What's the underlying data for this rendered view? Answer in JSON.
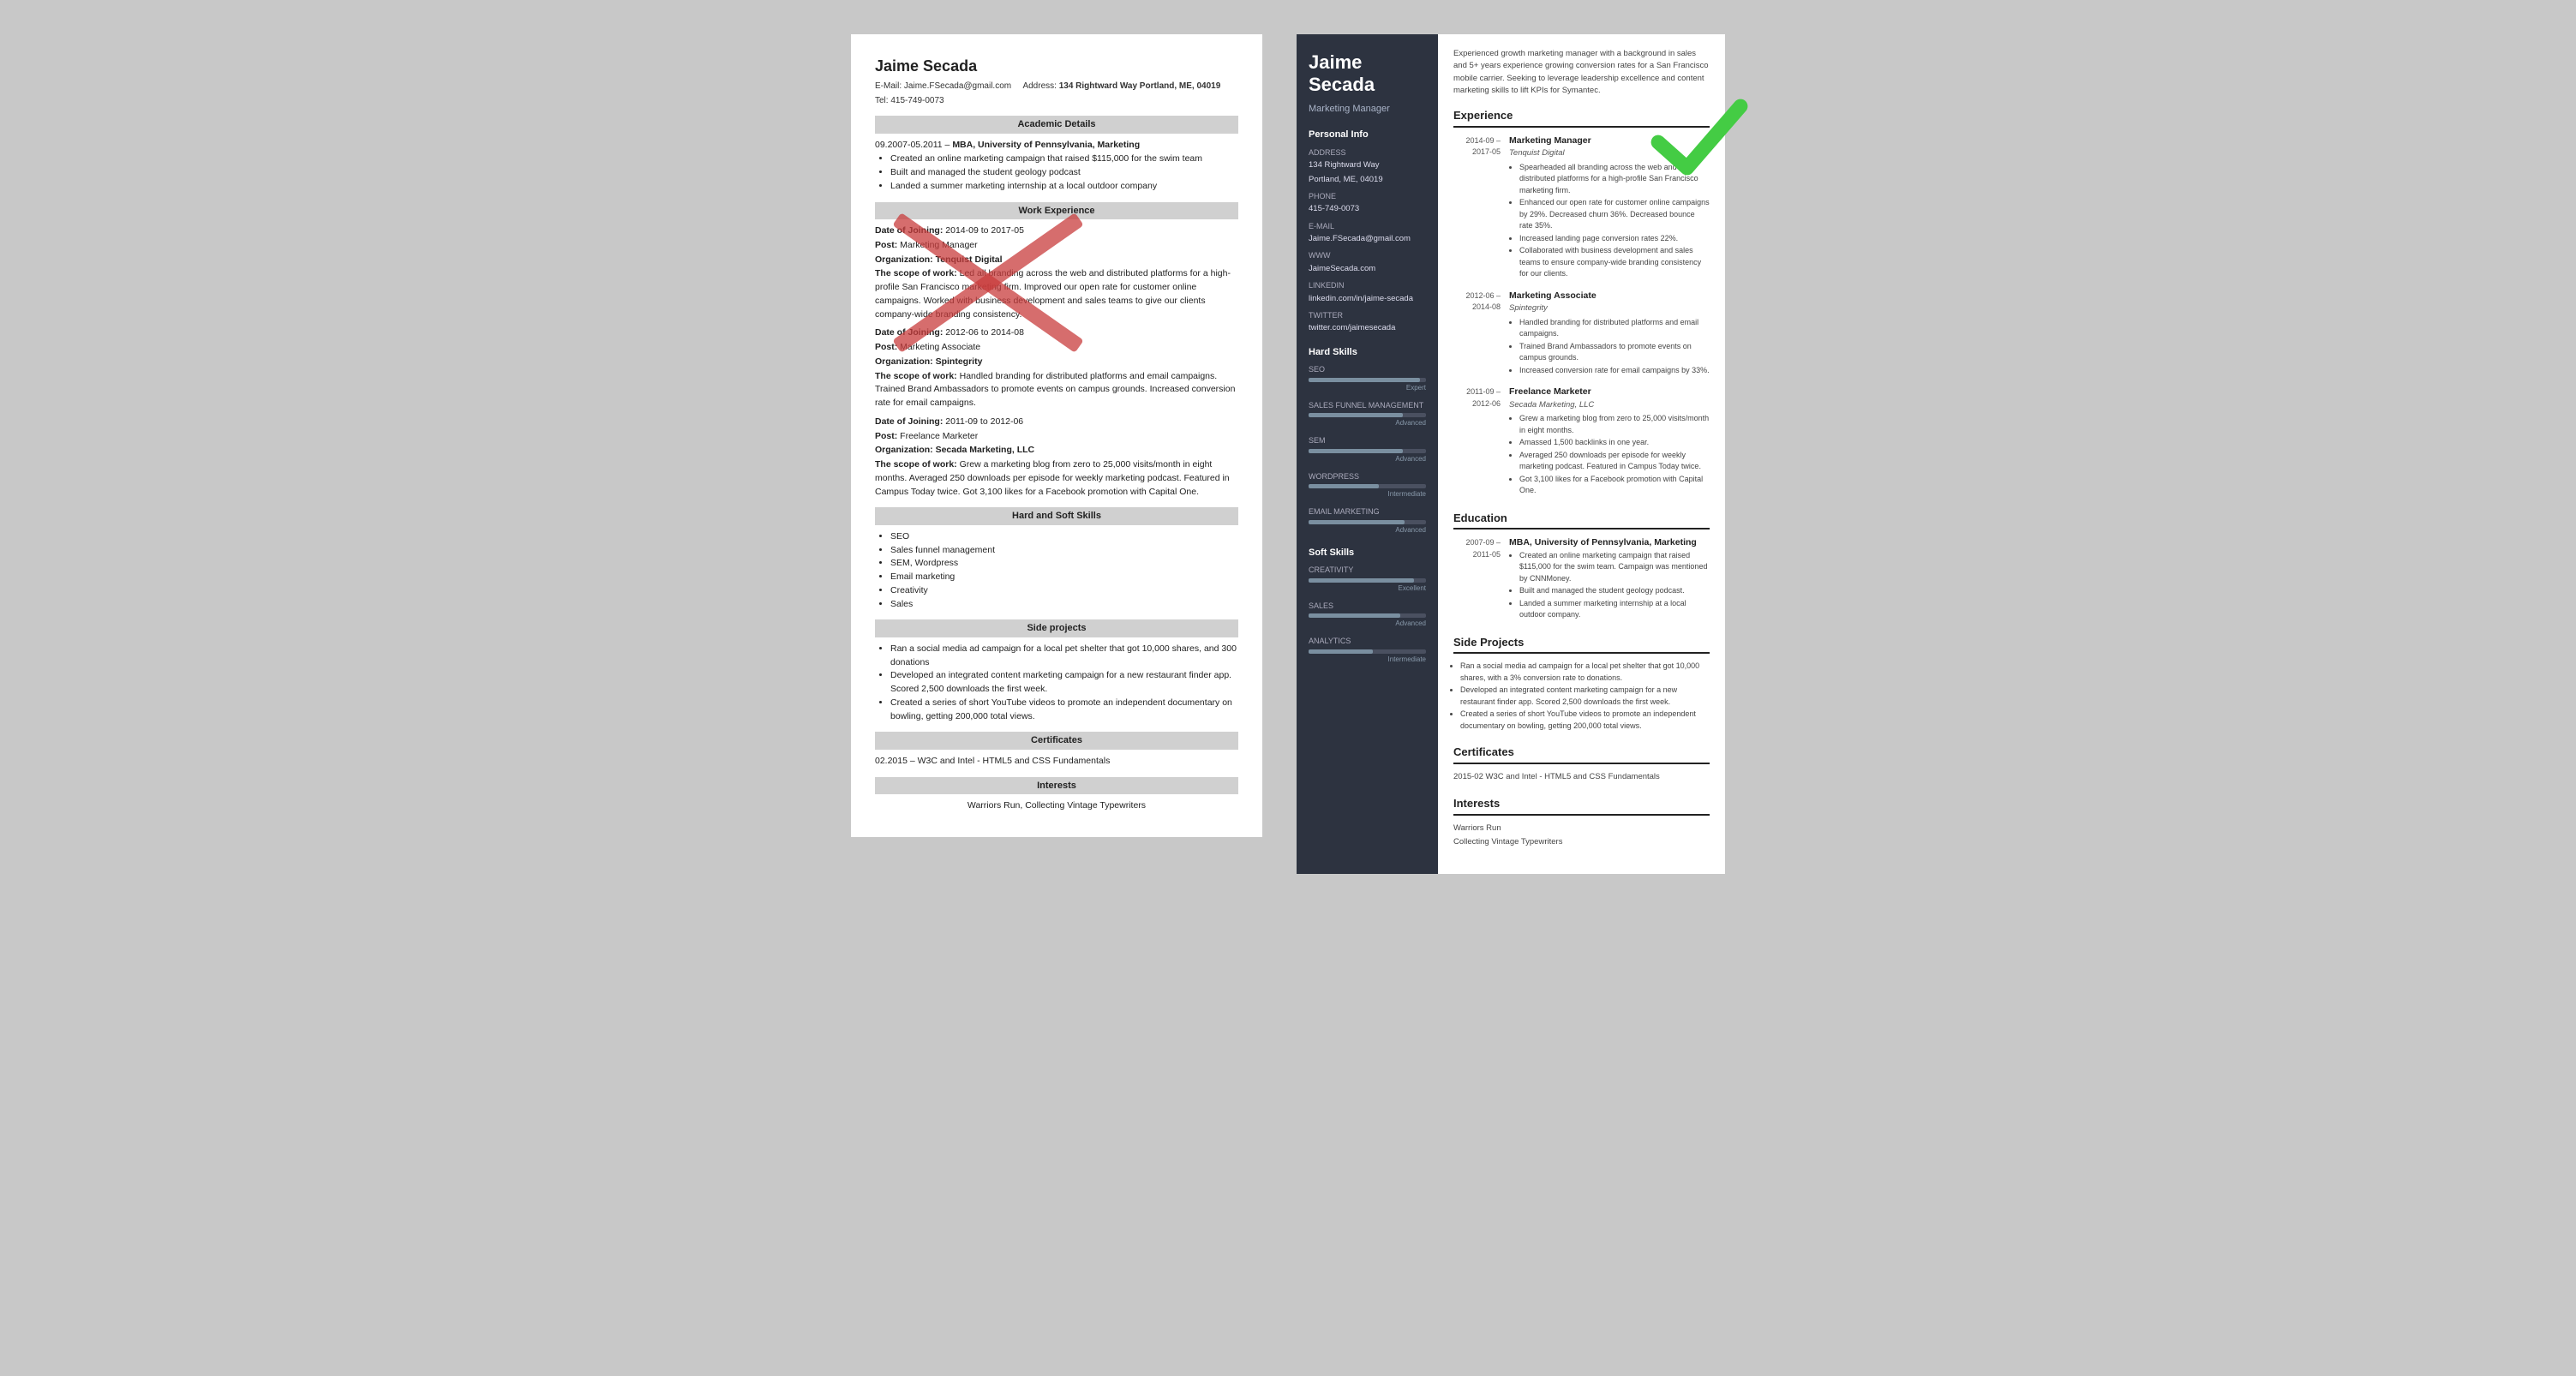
{
  "left_resume": {
    "name": "Jaime Secada",
    "email_label": "E-Mail:",
    "email": "Jaime.FSecada@gmail.com",
    "address_label": "Address:",
    "address": "134 Rightward Way Portland, ME, 04019",
    "tel_label": "Tel:",
    "tel": "415-749-0073",
    "sections": {
      "academic": {
        "title": "Academic Details",
        "entries": [
          {
            "date": "09.2007-05.2011 –",
            "degree": "MBA, University of Pennsylvania, Marketing",
            "bullets": [
              "Created an online marketing campaign that raised $115,000 for the swim team",
              "Built and managed the student geology podcast",
              "Landed a summer marketing internship at a local outdoor company"
            ]
          }
        ]
      },
      "work": {
        "title": "Work Experience",
        "entries": [
          {
            "date_label": "Date of Joining:",
            "date": "2014-09 to 2017-05",
            "post_label": "Post:",
            "post": "Marketing Manager",
            "org_label": "Organization:",
            "org": "Tenquist Digital",
            "scope_label": "The scope of work:",
            "scope": "Led all branding across the web and distributed platforms for a high-profile San Francisco marketing firm. Improved our open rate for customer online campaigns. Worked with business development and sales teams to give our clients company-wide branding consistency."
          },
          {
            "date_label": "Date of Joining:",
            "date": "2012-06 to 2014-08",
            "post_label": "Post:",
            "post": "Marketing Associate",
            "org_label": "Organization:",
            "org": "Spintegrity",
            "scope_label": "The scope of work:",
            "scope": "Handled branding for distributed platforms and email campaigns. Trained Brand Ambassadors to promote events on campus grounds. Increased conversion rate for email campaigns."
          },
          {
            "date_label": "Date of Joining:",
            "date": "2011-09 to 2012-06",
            "post_label": "Post:",
            "post": "Freelance Marketer",
            "org_label": "Organization:",
            "org": "Secada Marketing, LLC",
            "scope_label": "The scope of work:",
            "scope": "Grew a marketing blog from zero to 25,000 visits/month in eight months. Averaged 250 downloads per episode for weekly marketing podcast. Featured in Campus Today twice. Got 3,100 likes for a Facebook promotion with Capital One."
          }
        ]
      },
      "skills": {
        "title": "Hard and Soft Skills",
        "items": [
          "SEO",
          "Sales funnel management",
          "SEM, Wordpress",
          "Email marketing",
          "Creativity",
          "Sales"
        ]
      },
      "side_projects": {
        "title": "Side projects",
        "bullets": [
          "Ran a social media ad campaign for a local pet shelter that got 10,000 shares, and 300 donations",
          "Developed an integrated content marketing campaign for a new restaurant finder app. Scored 2,500 downloads the first week.",
          "Created a series of short YouTube videos to promote an independent documentary on bowling, getting 200,000 total views."
        ]
      },
      "certificates": {
        "title": "Certificates",
        "entry": "02.2015 –  W3C and Intel - HTML5 and CSS Fundamentals"
      },
      "interests": {
        "title": "Interests",
        "entry": "Warriors Run, Collecting Vintage Typewriters"
      }
    }
  },
  "right_resume": {
    "name": "Jaime Secada",
    "title": "Marketing Manager",
    "summary": "Experienced growth marketing manager with a background in sales and 5+ years experience growing conversion rates for a San Francisco mobile carrier. Seeking to leverage leadership excellence and content marketing skills to lift KPIs for Symantec.",
    "personal_info": {
      "section_title": "Personal Info",
      "address_label": "Address",
      "address_line1": "134 Rightward Way",
      "address_line2": "Portland, ME, 04019",
      "phone_label": "Phone",
      "phone": "415-749-0073",
      "email_label": "E-mail",
      "email": "Jaime.FSecada@gmail.com",
      "www_label": "WWW",
      "www": "JaimeSecada.com",
      "linkedin_label": "LinkedIn",
      "linkedin": "linkedin.com/in/jaime-secada",
      "twitter_label": "Twitter",
      "twitter": "twitter.com/jaimesecada"
    },
    "hard_skills": {
      "section_title": "Hard Skills",
      "skills": [
        {
          "name": "SEO",
          "level": "Expert",
          "pct": 95
        },
        {
          "name": "SALES FUNNEL MANAGEMENT",
          "level": "Advanced",
          "pct": 80
        },
        {
          "name": "SEM",
          "level": "Advanced",
          "pct": 80
        },
        {
          "name": "WORDPRESS",
          "level": "Intermediate",
          "pct": 60
        },
        {
          "name": "EMAIL MARKETING",
          "level": "Advanced",
          "pct": 82
        }
      ]
    },
    "soft_skills": {
      "section_title": "Soft Skills",
      "skills": [
        {
          "name": "CREATIVITY",
          "level": "Excellent",
          "pct": 90
        },
        {
          "name": "SALES",
          "level": "Advanced",
          "pct": 78
        },
        {
          "name": "ANALYTICS",
          "level": "Intermediate",
          "pct": 55
        }
      ]
    },
    "experience": {
      "section_title": "Experience",
      "entries": [
        {
          "dates": "2014-09 – 2017-05",
          "title": "Marketing Manager",
          "company": "Tenquist Digital",
          "bullets": [
            "Spearheaded all branding across the web and distributed platforms for a high-profile San Francisco marketing firm.",
            "Enhanced our open rate for customer online campaigns by 29%. Decreased churn 36%. Decreased bounce rate 35%.",
            "Increased landing page conversion rates 22%.",
            "Collaborated with business development and sales teams to ensure company-wide branding consistency for our clients."
          ]
        },
        {
          "dates": "2012-06 – 2014-08",
          "title": "Marketing Associate",
          "company": "Spintegrity",
          "bullets": [
            "Handled branding for distributed platforms and email campaigns.",
            "Trained Brand Ambassadors to promote events on campus grounds.",
            "Increased conversion rate for email campaigns by 33%."
          ]
        },
        {
          "dates": "2011-09 – 2012-06",
          "title": "Freelance Marketer",
          "company": "Secada Marketing, LLC",
          "bullets": [
            "Grew a marketing blog from zero to 25,000 visits/month in eight months.",
            "Amassed 1,500 backlinks in one year.",
            "Averaged 250 downloads per episode for weekly marketing podcast. Featured in Campus Today twice.",
            "Got 3,100 likes for a Facebook promotion with Capital One."
          ]
        }
      ]
    },
    "education": {
      "section_title": "Education",
      "entries": [
        {
          "dates": "2007-09 – 2011-05",
          "title": "MBA, University of Pennsylvania, Marketing",
          "company": "",
          "bullets": [
            "Created an online marketing campaign that raised $115,000 for the swim team. Campaign was mentioned by CNNMoney.",
            "Built and managed the student geology podcast.",
            "Landed a summer marketing internship at a local outdoor company."
          ]
        }
      ]
    },
    "side_projects": {
      "section_title": "Side Projects",
      "bullets": [
        "Ran a social media ad campaign for a local pet shelter that got 10,000 shares, with a 3% conversion rate to donations.",
        "Developed an integrated content marketing campaign for a new restaurant finder app. Scored 2,500 downloads the first week.",
        "Created a series of short YouTube videos to promote an independent documentary on bowling, getting 200,000 total views."
      ]
    },
    "certificates": {
      "section_title": "Certificates",
      "entry": "2015-02    W3C and Intel - HTML5 and CSS Fundamentals"
    },
    "interests": {
      "section_title": "Interests",
      "item1": "Warriors Run",
      "item2": "Collecting Vintage Typewriters"
    }
  }
}
